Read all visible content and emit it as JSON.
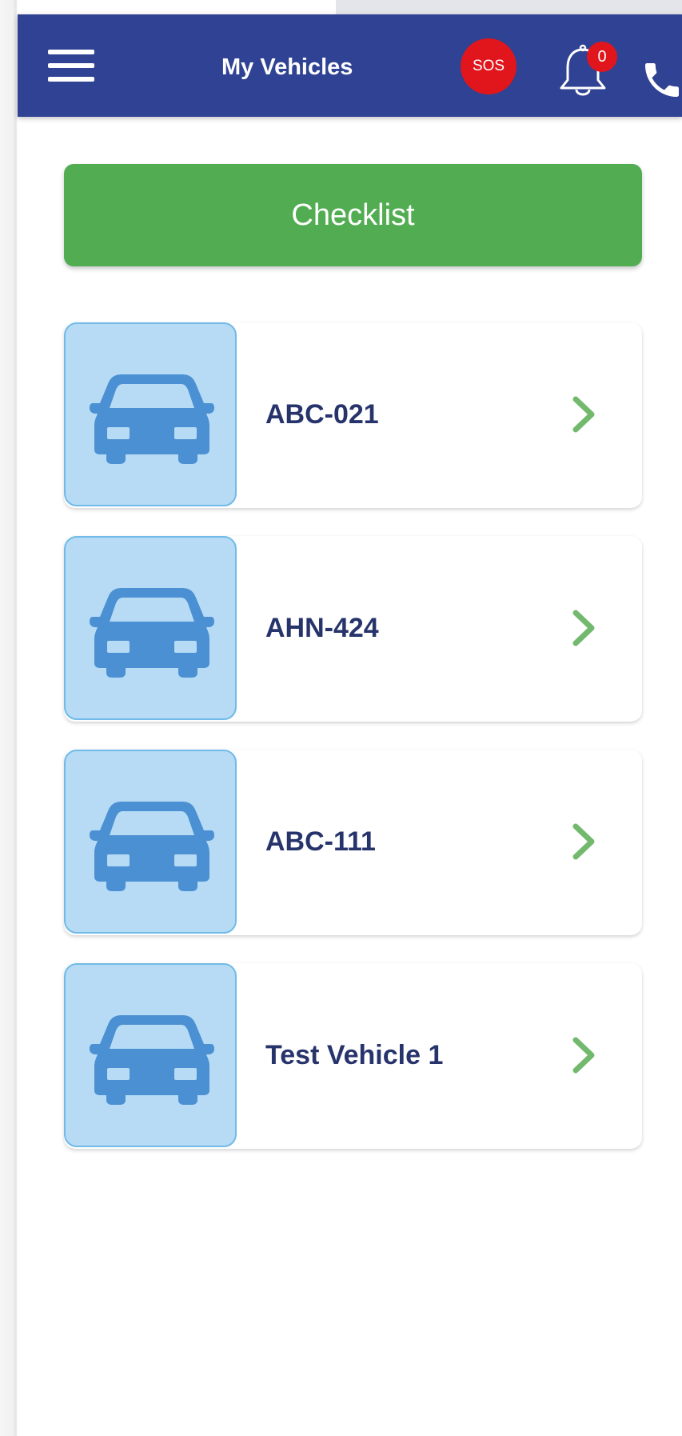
{
  "header": {
    "title": "My Vehicles",
    "menu_icon": "hamburger-menu-icon",
    "sos_label": "SOS",
    "notification_icon": "bell-icon",
    "notification_count": "0",
    "call_icon": "phone-icon",
    "background_color": "#2f4293"
  },
  "checklist": {
    "label": "Checklist",
    "color": "#52ad52"
  },
  "vehicles": [
    {
      "name": "ABC-021",
      "icon": "car-icon"
    },
    {
      "name": "AHN-424",
      "icon": "car-icon"
    },
    {
      "name": "ABC-111",
      "icon": "car-icon"
    },
    {
      "name": "Test Vehicle 1",
      "icon": "car-icon"
    }
  ],
  "colors": {
    "vehicle_name": "#27346c",
    "car_icon": "#4a90d2",
    "thumb_background": "#b7daf5",
    "chevron": "#72b96d",
    "sos": "#e0161c"
  }
}
